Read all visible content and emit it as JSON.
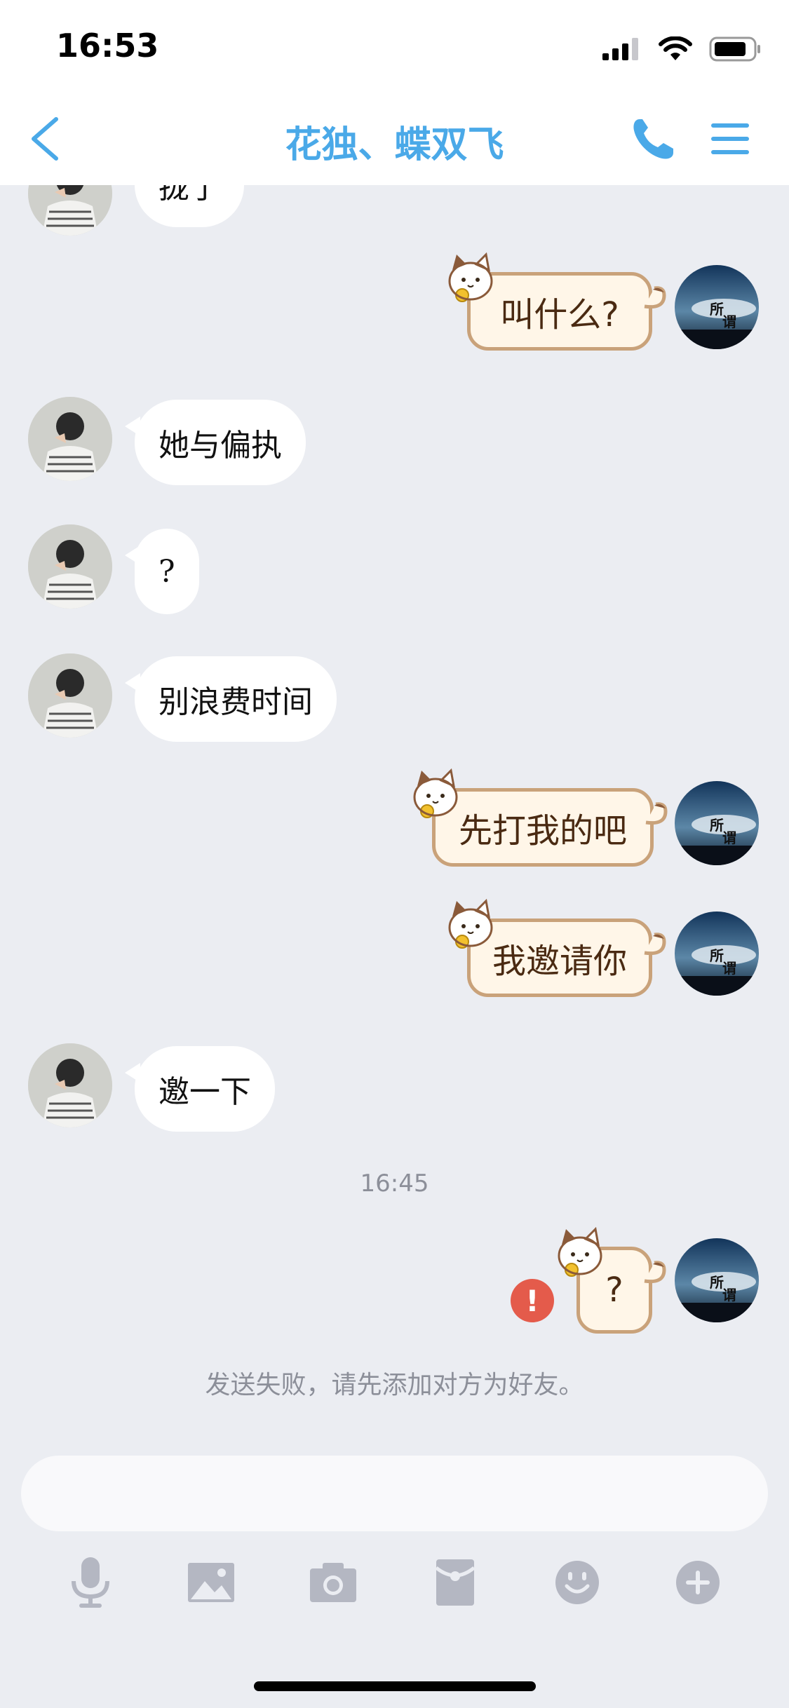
{
  "status_bar": {
    "time": "16:53"
  },
  "nav": {
    "title": "花独、蝶双飞"
  },
  "messages": [
    {
      "side": "left",
      "text": "拢了"
    },
    {
      "side": "right",
      "text": "叫什么?"
    },
    {
      "side": "left",
      "text": "她与偏执"
    },
    {
      "side": "left",
      "text": "?"
    },
    {
      "side": "left",
      "text": "别浪费时间"
    },
    {
      "side": "right",
      "text": "先打我的吧"
    },
    {
      "side": "right",
      "text": "我邀请你"
    },
    {
      "side": "left",
      "text": "邀一下"
    },
    {
      "side": "right",
      "text": "?"
    }
  ],
  "timestamp": "16:45",
  "failed_icon_text": "!",
  "failed_notice": "发送失败，请先添加对方为好友。",
  "input": {
    "placeholder": "",
    "value": ""
  },
  "toolbar": {
    "icons": [
      "microphone-icon",
      "image-icon",
      "camera-icon",
      "red-packet-icon",
      "emoji-icon",
      "plus-icon"
    ]
  },
  "colors": {
    "accent": "#4aa9e8",
    "background": "#ebedf2",
    "error": "#e45b4b",
    "bubble_right_border": "#c9a27a"
  }
}
